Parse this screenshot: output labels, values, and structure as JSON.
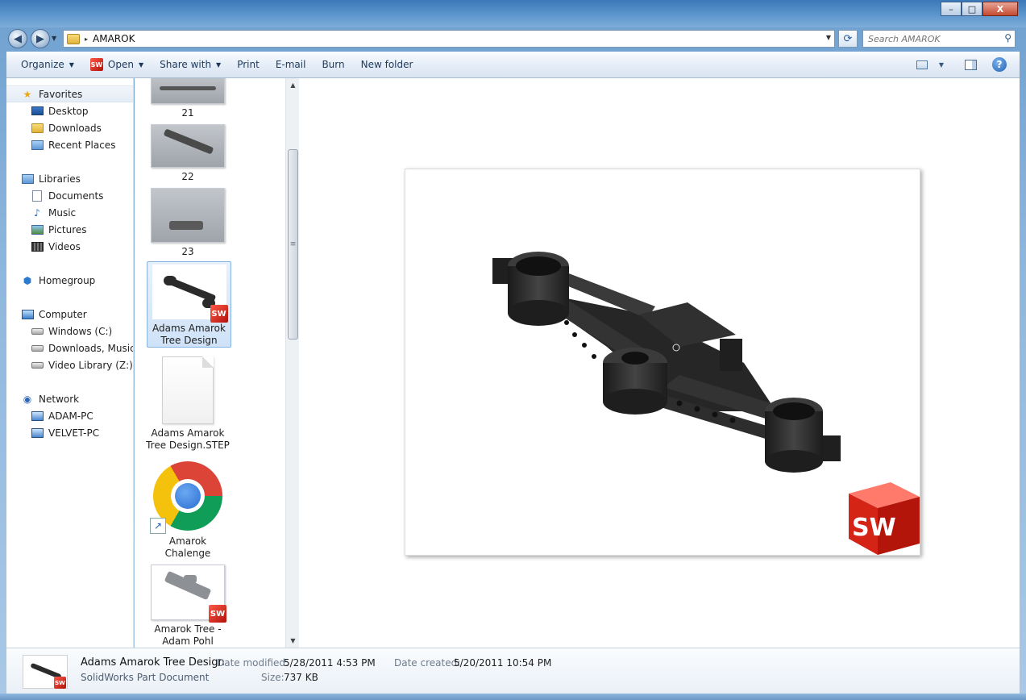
{
  "window": {
    "title": "",
    "controls": {
      "minimize": "–",
      "maximize": "□",
      "close": "X"
    }
  },
  "nav_buttons": {
    "back": "◀",
    "forward": "▶"
  },
  "address": {
    "path_arrow": "▸",
    "path": "AMAROK",
    "dropdown": "▼"
  },
  "search": {
    "placeholder": "Search AMAROK",
    "icon": "magnifier-icon"
  },
  "toolbar": {
    "organize": "Organize",
    "open": "Open",
    "share_with": "Share with",
    "print": "Print",
    "email": "E-mail",
    "burn": "Burn",
    "new_folder": "New folder",
    "dropdown_glyph": "▼"
  },
  "sidebar": {
    "favorites": {
      "label": "Favorites",
      "items": [
        "Desktop",
        "Downloads",
        "Recent Places"
      ]
    },
    "libraries": {
      "label": "Libraries",
      "items": [
        "Documents",
        "Music",
        "Pictures",
        "Videos"
      ]
    },
    "homegroup": {
      "label": "Homegroup"
    },
    "computer": {
      "label": "Computer",
      "items": [
        "Windows (C:)",
        "Downloads, Music, E",
        "Video Library (Z:)"
      ]
    },
    "network": {
      "label": "Network",
      "items": [
        "ADAM-PC",
        "VELVET-PC"
      ]
    }
  },
  "files": [
    {
      "name": "21"
    },
    {
      "name": "22"
    },
    {
      "name": "23"
    },
    {
      "name": "Adams Amarok Tree Design",
      "selected": true,
      "badge": "SW"
    },
    {
      "name": "Adams Amarok Tree Design.STEP"
    },
    {
      "name": "Amarok Chalenge"
    },
    {
      "name": "Amarok Tree - Adam Pohl",
      "badge": "SW"
    }
  ],
  "preview": {
    "logo": "SW"
  },
  "details": {
    "name": "Adams Amarok Tree Design",
    "type": "SolidWorks Part Document",
    "date_modified_label": "Date modified:",
    "date_modified": "5/28/2011 4:53 PM",
    "size_label": "Size:",
    "size": "737 KB",
    "date_created_label": "Date created:",
    "date_created": "5/20/2011 10:54 PM"
  },
  "scrollbar": {
    "up": "▲",
    "down": "▼",
    "grip": "≡"
  }
}
